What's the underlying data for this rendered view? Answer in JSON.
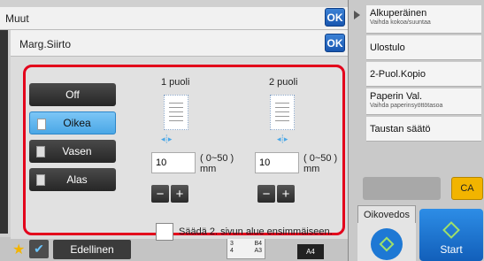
{
  "background": {
    "window_title": "Muut",
    "ok_label": "OK"
  },
  "dialog": {
    "title": "Marg.Siirto",
    "ok_label": "OK",
    "options": [
      {
        "label": "Off",
        "selected": false
      },
      {
        "label": "Oikea",
        "selected": true
      },
      {
        "label": "Vasen",
        "selected": false
      },
      {
        "label": "Alas",
        "selected": false
      }
    ],
    "side1": {
      "label": "1 puoli",
      "value": "10",
      "range": "( 0~50 )",
      "unit": "mm"
    },
    "side2": {
      "label": "2 puoli",
      "value": "10",
      "range": "( 0~50 )",
      "unit": "mm"
    },
    "minus_label": "−",
    "plus_label": "+",
    "checkbox_label": "Säädä 2. sivun alue ensimmäiseen."
  },
  "right_panel": {
    "items": [
      {
        "label": "Alkuperäinen",
        "sub": "Vaihda kokoa/suuntaa"
      },
      {
        "label": "Ulostulo",
        "sub": ""
      },
      {
        "label": "2-Puol.Kopio",
        "sub": ""
      },
      {
        "label": "Paperin Val.",
        "sub": "Vaihda paperinsyöttötasoa"
      },
      {
        "label": "Taustan säätö",
        "sub": ""
      }
    ],
    "ca_label": "CA",
    "preview_label": "Oikovedos",
    "start_label": "Start"
  },
  "bottom_bar": {
    "prev_label": "Edellinen",
    "tray_rows": [
      {
        "num": "3",
        "size": "B4"
      },
      {
        "num": "4",
        "size": "A3"
      }
    ],
    "paper_size": "A4"
  },
  "colors": {
    "accent_blue": "#1856b0",
    "selected_blue": "#4aa7e6",
    "highlight_red": "#e3001b",
    "ca_yellow": "#f2b400"
  }
}
